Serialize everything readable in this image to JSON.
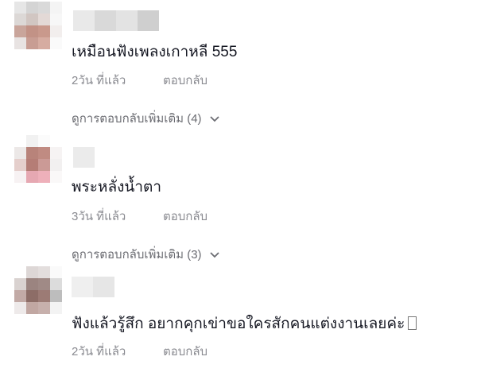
{
  "comments": [
    {
      "text": "เหมือนฟังเพลงเกาหลี 555",
      "time": "2วัน ที่แล้ว",
      "reply_label": "ตอบกลับ",
      "more_replies": "ดูการตอบกลับเพิ่มเติม (4)"
    },
    {
      "text": "พระหลั่งน้ำตา",
      "time": "3วัน ที่แล้ว",
      "reply_label": "ตอบกลับ",
      "more_replies": "ดูการตอบกลับเพิ่มเติม (3)"
    },
    {
      "text": "ฟังแล้วรู้สึก อยากคุกเข่าขอใครสักคนแต่งงานเลยค่ะ",
      "time": "2วัน ที่แล้ว",
      "reply_label": "ตอบกลับ"
    }
  ],
  "icons": {
    "chevron": "chevron-down-icon",
    "emoji_placeholder": "missing-glyph-icon"
  }
}
